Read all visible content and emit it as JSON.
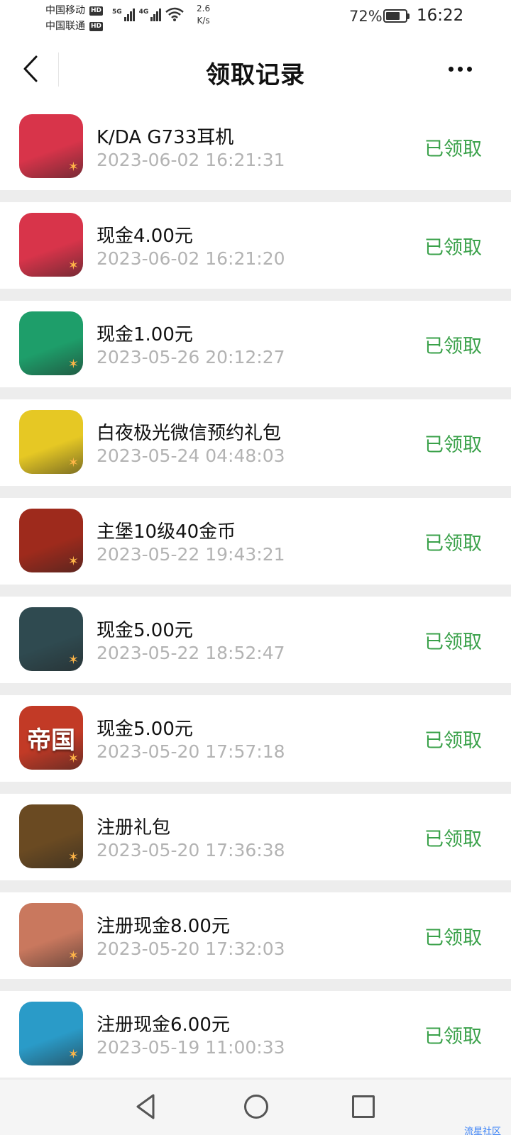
{
  "status_bar": {
    "carrier1": "中国移动",
    "carrier2": "中国联通",
    "hd_badge": "HD",
    "network1": "5G",
    "network2": "4G",
    "speed_value": "2.6",
    "speed_unit": "K/s",
    "battery_percent": "72%",
    "battery_level": 0.72,
    "time": "16:22"
  },
  "nav": {
    "title": "领取记录",
    "back_icon": "chevron-left-icon",
    "more_icon": "more-dots-icon"
  },
  "records": [
    {
      "name": "K/DA G733耳机",
      "time": "2023-06-02 16:21:31",
      "status": "已领取",
      "icon_text": "",
      "icon_color": "#d8344a"
    },
    {
      "name": "现金4.00元",
      "time": "2023-06-02 16:21:20",
      "status": "已领取",
      "icon_text": "",
      "icon_color": "#d8344a"
    },
    {
      "name": "现金1.00元",
      "time": "2023-05-26 20:12:27",
      "status": "已领取",
      "icon_text": "",
      "icon_color": "#1e9e6a"
    },
    {
      "name": "白夜极光微信预约礼包",
      "time": "2023-05-24 04:48:03",
      "status": "已领取",
      "icon_text": "",
      "icon_color": "#e6c824"
    },
    {
      "name": "主堡10级40金币",
      "time": "2023-05-22 19:43:21",
      "status": "已领取",
      "icon_text": "",
      "icon_color": "#9e2a1c"
    },
    {
      "name": "现金5.00元",
      "time": "2023-05-22 18:52:47",
      "status": "已领取",
      "icon_text": "",
      "icon_color": "#2f4a50"
    },
    {
      "name": "现金5.00元",
      "time": "2023-05-20 17:57:18",
      "status": "已领取",
      "icon_text": "帝国",
      "icon_color": "#c23a26"
    },
    {
      "name": "注册礼包",
      "time": "2023-05-20 17:36:38",
      "status": "已领取",
      "icon_text": "",
      "icon_color": "#6a4a22"
    },
    {
      "name": "注册现金8.00元",
      "time": "2023-05-20 17:32:03",
      "status": "已领取",
      "icon_text": "",
      "icon_color": "#c9785e"
    },
    {
      "name": "注册现金6.00元",
      "time": "2023-05-19 11:00:33",
      "status": "已领取",
      "icon_text": "",
      "icon_color": "#2a9bc8"
    }
  ],
  "system_nav": {
    "back_icon": "triangle-back-icon",
    "home_icon": "circle-home-icon",
    "recent_icon": "square-recents-icon"
  },
  "watermark": "流星社区"
}
